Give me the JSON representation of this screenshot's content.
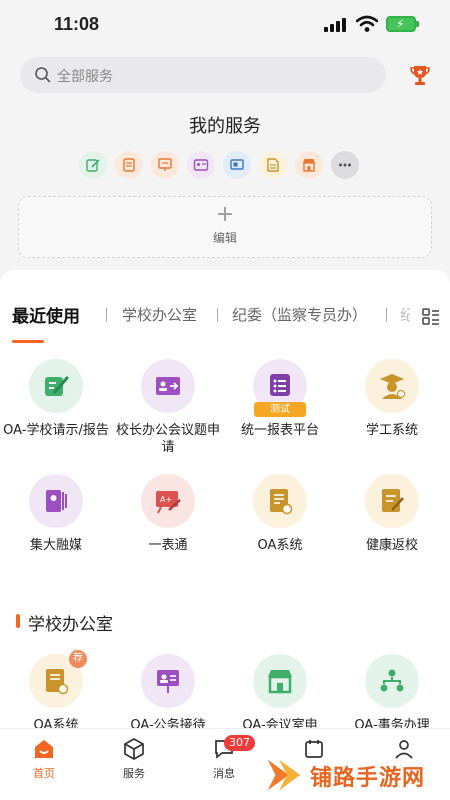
{
  "status_bar": {
    "time": "11:08"
  },
  "search": {
    "placeholder": "全部服务"
  },
  "my_services": {
    "title": "我的服务",
    "edit_label": "编辑",
    "icons": [
      "edit-doc-icon",
      "report-doc-icon",
      "presentation-icon",
      "id-card-icon",
      "screen-icon",
      "document-icon",
      "store-icon",
      "more-icon"
    ]
  },
  "tabs": [
    "最近使用",
    "学校办公室",
    "纪委（监察专员办）"
  ],
  "recent_apps": [
    {
      "label": "OA-学校请示/报告",
      "icon": "edit-doc-icon",
      "color": "#e3f3ea",
      "fg": "#3fae6a"
    },
    {
      "label": "校长办公会议题申请",
      "icon": "screen-arrow-icon",
      "color": "#f1e6f6",
      "fg": "#9b4fc0"
    },
    {
      "label": "统一报表平台",
      "icon": "list-icon",
      "color": "#f1e6f6",
      "fg": "#7f3fa8",
      "tag": "测试"
    },
    {
      "label": "学工系统",
      "icon": "graduate-icon",
      "color": "#fbf1dc",
      "fg": "#c9952a"
    },
    {
      "label": "集大融媒",
      "icon": "media-icon",
      "color": "#f1e6f6",
      "fg": "#9b4fc0"
    },
    {
      "label": "一表通",
      "icon": "chalkboard-icon",
      "color": "#fbe5e3",
      "fg": "#d9534f"
    },
    {
      "label": "OA系统",
      "icon": "oa-doc-icon",
      "color": "#fbf1dc",
      "fg": "#c9952a"
    },
    {
      "label": "健康返校",
      "icon": "health-doc-icon",
      "color": "#fbf1dc",
      "fg": "#c9952a"
    }
  ],
  "section": {
    "title": "学校办公室",
    "apps": [
      {
        "label": "OA系统",
        "icon": "oa-doc-icon",
        "color": "#fbf1dc",
        "fg": "#c9952a",
        "tag": "荐"
      },
      {
        "label": "OA-公务接待",
        "icon": "presentation-icon",
        "color": "#f1e6f6",
        "fg": "#9b4fc0"
      },
      {
        "label": "OA-会议室申",
        "icon": "store-icon",
        "color": "#e3f3ea",
        "fg": "#3fae6a"
      },
      {
        "label": "OA-事务办理",
        "icon": "org-chart-icon",
        "color": "#e3f3ea",
        "fg": "#3fae6a"
      }
    ]
  },
  "bottom_nav": {
    "items": [
      {
        "label": "首页",
        "icon": "home-icon",
        "active": true
      },
      {
        "label": "服务",
        "icon": "cube-icon"
      },
      {
        "label": "消息",
        "icon": "chat-icon",
        "badge": "307"
      }
    ]
  },
  "watermark": "铺路手游网",
  "colors": {
    "accent": "#f26522",
    "badge": "#f23a3a"
  }
}
